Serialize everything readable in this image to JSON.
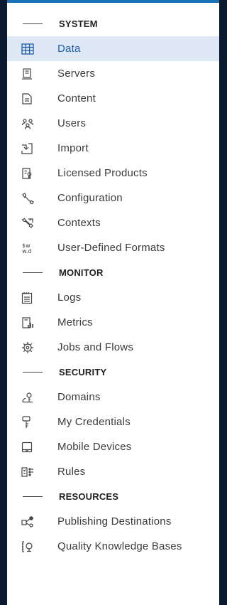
{
  "colors": {
    "active_bg": "#dde8f4",
    "active_text": "#1f5fa8",
    "accent": "#1b73b6",
    "text": "#3b3b3b"
  },
  "sections": [
    {
      "title": "SYSTEM",
      "items": [
        {
          "label": "Data",
          "icon": "table-icon",
          "active": true
        },
        {
          "label": "Servers",
          "icon": "server-icon"
        },
        {
          "label": "Content",
          "icon": "document-icon"
        },
        {
          "label": "Users",
          "icon": "users-icon"
        },
        {
          "label": "Import",
          "icon": "import-icon"
        },
        {
          "label": "Licensed Products",
          "icon": "license-icon"
        },
        {
          "label": "Configuration",
          "icon": "wrench-icon"
        },
        {
          "label": "Contexts",
          "icon": "contexts-icon"
        },
        {
          "label": "User-Defined Formats",
          "icon": "formats-icon"
        }
      ]
    },
    {
      "title": "MONITOR",
      "items": [
        {
          "label": "Logs",
          "icon": "logs-icon"
        },
        {
          "label": "Metrics",
          "icon": "metrics-icon"
        },
        {
          "label": "Jobs and Flows",
          "icon": "gear-icon"
        }
      ]
    },
    {
      "title": "SECURITY",
      "items": [
        {
          "label": "Domains",
          "icon": "domains-icon"
        },
        {
          "label": "My Credentials",
          "icon": "key-icon"
        },
        {
          "label": "Mobile Devices",
          "icon": "mobile-device-icon"
        },
        {
          "label": "Rules",
          "icon": "rules-icon"
        }
      ]
    },
    {
      "title": "RESOURCES",
      "items": [
        {
          "label": "Publishing Destinations",
          "icon": "publish-icon"
        },
        {
          "label": "Quality Knowledge Bases",
          "icon": "knowledge-base-icon"
        }
      ]
    }
  ]
}
